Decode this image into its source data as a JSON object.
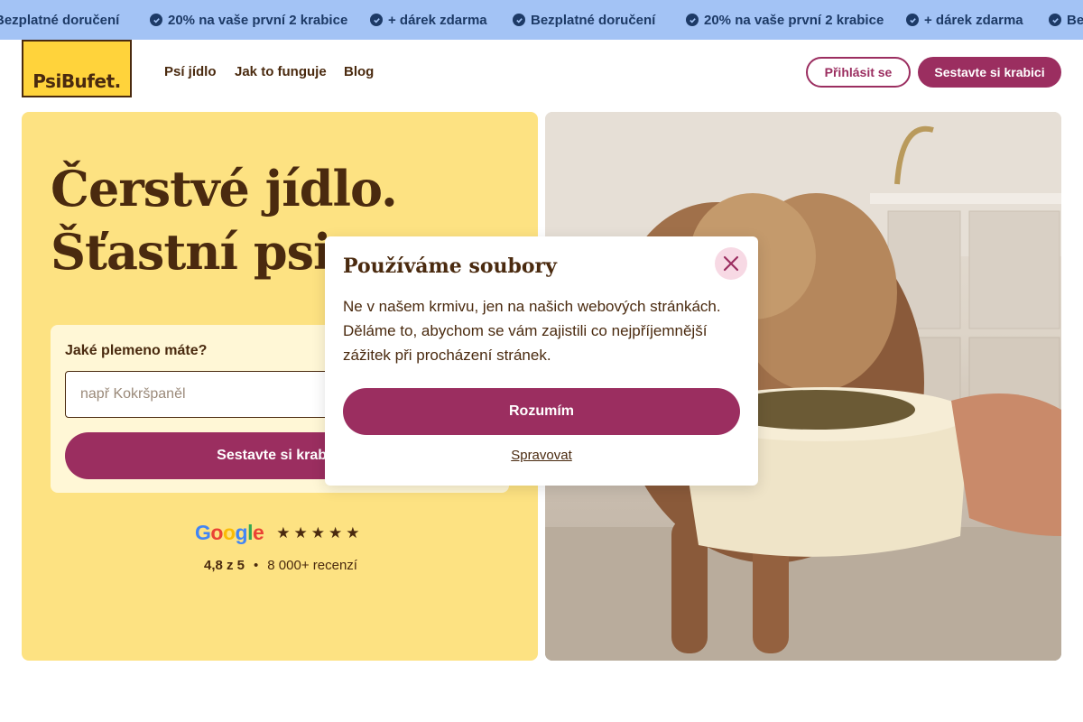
{
  "promo": {
    "items": [
      "Bezplatné doručení",
      "20% na vaše první 2 krabice",
      "+ dárek zdarma",
      "Bezplatné doručení",
      "20% na vaše první 2 krabice",
      "+ dárek zdarma",
      "Bez"
    ]
  },
  "header": {
    "logo_text": "PsiBufet.",
    "nav": [
      "Psí jídlo",
      "Jak to funguje",
      "Blog"
    ],
    "login_label": "Přihlásit se",
    "build_box_label": "Sestavte si krabici"
  },
  "hero": {
    "title_line1": "Čerstvé jídlo.",
    "title_line2": "Šťastní psi.",
    "breed_label": "Jaké plemeno máte?",
    "breed_placeholder": "např Kokršpaněl",
    "build_button_label": "Sestavte si krabici",
    "google_text": "Google",
    "rating": "4,8 z 5",
    "separator": "•",
    "reviews": "8 000+ recenzí",
    "stars": 5
  },
  "modal": {
    "title": "Používáme soubory",
    "text": "Ne v našem krmivu, jen na našich webových stránkách. Děláme to, abychom se vám zajistili co nejpříjemnější zážitek při procházení stránek.",
    "accept_label": "Rozumím",
    "manage_label": "Spravovat"
  },
  "colors": {
    "promo_bg": "#a3c3f5",
    "brand_yellow": "#ffd33b",
    "hero_bg": "#fde282",
    "primary": "#9b2e60",
    "text_brown": "#4a2a0f"
  }
}
